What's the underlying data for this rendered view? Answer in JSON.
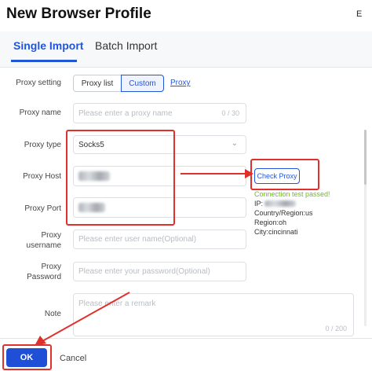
{
  "window": {
    "title": "New Browser Profile",
    "corner_text": "E"
  },
  "tabs": [
    {
      "label": "Single Import"
    },
    {
      "label": "Batch Import"
    }
  ],
  "form": {
    "proxy_setting": {
      "label": "Proxy setting",
      "options": [
        "Proxy list",
        "Custom"
      ],
      "selected": "Custom",
      "link": "Proxy"
    },
    "proxy_name": {
      "label": "Proxy name",
      "placeholder": "Please enter a proxy name",
      "counter": "0 / 30"
    },
    "proxy_type": {
      "label": "Proxy type",
      "value": "Socks5"
    },
    "proxy_host": {
      "label": "Proxy Host"
    },
    "proxy_port": {
      "label": "Proxy Port"
    },
    "proxy_username": {
      "label_line1": "Proxy",
      "label_line2": "username",
      "placeholder": "Please enter user name(Optional)"
    },
    "proxy_password": {
      "label_line1": "Proxy",
      "label_line2": "Password",
      "placeholder": "Please enter your password(Optional)"
    },
    "note": {
      "label": "Note",
      "placeholder": "Please enter a remark",
      "counter": "0 / 200"
    }
  },
  "check_proxy": {
    "button": "Check Proxy",
    "result_title": "Connection test passed!",
    "ip": "IP:",
    "country": "Country/Region:us",
    "region": "Region:oh",
    "city": "City:cincinnati"
  },
  "footer": {
    "ok": "OK",
    "cancel": "Cancel"
  },
  "colors": {
    "accent": "#2255d8",
    "annotation_red": "#e0302b",
    "success_green": "#6bbf1a"
  }
}
